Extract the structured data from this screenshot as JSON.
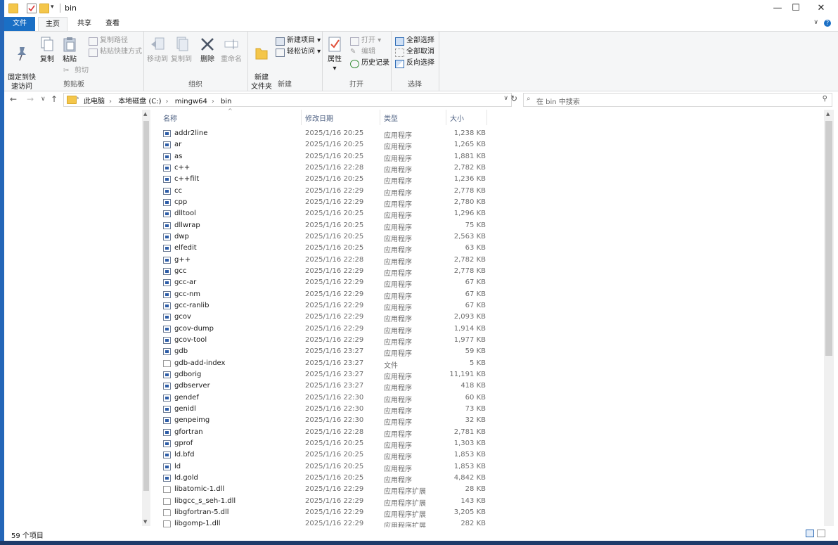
{
  "window": {
    "title": "bin"
  },
  "tabs": [
    {
      "label": "文件"
    },
    {
      "label": "主页"
    },
    {
      "label": "共享"
    },
    {
      "label": "查看"
    }
  ],
  "ribbon": {
    "clipboard": {
      "label": "剪贴板",
      "pin": "固定到快\n速访问",
      "copy": "复制",
      "paste": "粘贴",
      "copy_path": "复制路径",
      "paste_shortcut": "粘贴快捷方式",
      "cut": "剪切"
    },
    "organize": {
      "label": "组织",
      "move_to": "移动到",
      "copy_to": "复制到",
      "delete": "删除",
      "rename": "重命名"
    },
    "new": {
      "label": "新建",
      "new_folder": "新建\n文件夹",
      "new_item": "新建项目",
      "easy_access": "轻松访问"
    },
    "open": {
      "label": "打开",
      "properties": "属性",
      "open": "打开",
      "edit": "编辑",
      "history": "历史记录"
    },
    "select": {
      "label": "选择",
      "select_all": "全部选择",
      "select_none": "全部取消",
      "invert": "反向选择"
    }
  },
  "address": {
    "crumbs": [
      "此电脑",
      "本地磁盘 (C:)",
      "mingw64",
      "bin"
    ]
  },
  "search": {
    "placeholder": "在 bin 中搜索"
  },
  "columns": {
    "name": "名称",
    "date": "修改日期",
    "type": "类型",
    "size": "大小"
  },
  "files": [
    {
      "name": "addr2line",
      "date": "2025/1/16 20:25",
      "type": "应用程序",
      "size": "1,238 KB",
      "icon": "exe"
    },
    {
      "name": "ar",
      "date": "2025/1/16 20:25",
      "type": "应用程序",
      "size": "1,265 KB",
      "icon": "exe"
    },
    {
      "name": "as",
      "date": "2025/1/16 20:25",
      "type": "应用程序",
      "size": "1,881 KB",
      "icon": "exe"
    },
    {
      "name": "c++",
      "date": "2025/1/16 22:28",
      "type": "应用程序",
      "size": "2,782 KB",
      "icon": "exe"
    },
    {
      "name": "c++filt",
      "date": "2025/1/16 20:25",
      "type": "应用程序",
      "size": "1,236 KB",
      "icon": "exe"
    },
    {
      "name": "cc",
      "date": "2025/1/16 22:29",
      "type": "应用程序",
      "size": "2,778 KB",
      "icon": "exe"
    },
    {
      "name": "cpp",
      "date": "2025/1/16 22:29",
      "type": "应用程序",
      "size": "2,780 KB",
      "icon": "exe"
    },
    {
      "name": "dlltool",
      "date": "2025/1/16 20:25",
      "type": "应用程序",
      "size": "1,296 KB",
      "icon": "exe"
    },
    {
      "name": "dllwrap",
      "date": "2025/1/16 20:25",
      "type": "应用程序",
      "size": "75 KB",
      "icon": "exe"
    },
    {
      "name": "dwp",
      "date": "2025/1/16 20:25",
      "type": "应用程序",
      "size": "2,563 KB",
      "icon": "exe"
    },
    {
      "name": "elfedit",
      "date": "2025/1/16 20:25",
      "type": "应用程序",
      "size": "63 KB",
      "icon": "exe"
    },
    {
      "name": "g++",
      "date": "2025/1/16 22:28",
      "type": "应用程序",
      "size": "2,782 KB",
      "icon": "exe"
    },
    {
      "name": "gcc",
      "date": "2025/1/16 22:29",
      "type": "应用程序",
      "size": "2,778 KB",
      "icon": "exe"
    },
    {
      "name": "gcc-ar",
      "date": "2025/1/16 22:29",
      "type": "应用程序",
      "size": "67 KB",
      "icon": "exe"
    },
    {
      "name": "gcc-nm",
      "date": "2025/1/16 22:29",
      "type": "应用程序",
      "size": "67 KB",
      "icon": "exe"
    },
    {
      "name": "gcc-ranlib",
      "date": "2025/1/16 22:29",
      "type": "应用程序",
      "size": "67 KB",
      "icon": "exe"
    },
    {
      "name": "gcov",
      "date": "2025/1/16 22:29",
      "type": "应用程序",
      "size": "2,093 KB",
      "icon": "exe"
    },
    {
      "name": "gcov-dump",
      "date": "2025/1/16 22:29",
      "type": "应用程序",
      "size": "1,914 KB",
      "icon": "exe"
    },
    {
      "name": "gcov-tool",
      "date": "2025/1/16 22:29",
      "type": "应用程序",
      "size": "1,977 KB",
      "icon": "exe"
    },
    {
      "name": "gdb",
      "date": "2025/1/16 23:27",
      "type": "应用程序",
      "size": "59 KB",
      "icon": "exe"
    },
    {
      "name": "gdb-add-index",
      "date": "2025/1/16 23:27",
      "type": "文件",
      "size": "5 KB",
      "icon": "doc"
    },
    {
      "name": "gdborig",
      "date": "2025/1/16 23:27",
      "type": "应用程序",
      "size": "11,191 KB",
      "icon": "exe"
    },
    {
      "name": "gdbserver",
      "date": "2025/1/16 23:27",
      "type": "应用程序",
      "size": "418 KB",
      "icon": "exe"
    },
    {
      "name": "gendef",
      "date": "2025/1/16 22:30",
      "type": "应用程序",
      "size": "60 KB",
      "icon": "exe"
    },
    {
      "name": "genidl",
      "date": "2025/1/16 22:30",
      "type": "应用程序",
      "size": "73 KB",
      "icon": "exe"
    },
    {
      "name": "genpeimg",
      "date": "2025/1/16 22:30",
      "type": "应用程序",
      "size": "32 KB",
      "icon": "exe"
    },
    {
      "name": "gfortran",
      "date": "2025/1/16 22:28",
      "type": "应用程序",
      "size": "2,781 KB",
      "icon": "exe"
    },
    {
      "name": "gprof",
      "date": "2025/1/16 20:25",
      "type": "应用程序",
      "size": "1,303 KB",
      "icon": "exe"
    },
    {
      "name": "ld.bfd",
      "date": "2025/1/16 20:25",
      "type": "应用程序",
      "size": "1,853 KB",
      "icon": "exe"
    },
    {
      "name": "ld",
      "date": "2025/1/16 20:25",
      "type": "应用程序",
      "size": "1,853 KB",
      "icon": "exe"
    },
    {
      "name": "ld.gold",
      "date": "2025/1/16 20:25",
      "type": "应用程序",
      "size": "4,842 KB",
      "icon": "exe"
    },
    {
      "name": "libatomic-1.dll",
      "date": "2025/1/16 22:29",
      "type": "应用程序扩展",
      "size": "28 KB",
      "icon": "dll"
    },
    {
      "name": "libgcc_s_seh-1.dll",
      "date": "2025/1/16 22:29",
      "type": "应用程序扩展",
      "size": "143 KB",
      "icon": "dll"
    },
    {
      "name": "libgfortran-5.dll",
      "date": "2025/1/16 22:29",
      "type": "应用程序扩展",
      "size": "3,205 KB",
      "icon": "dll"
    },
    {
      "name": "libgomp-1.dll",
      "date": "2025/1/16 22:29",
      "type": "应用程序扩展",
      "size": "282 KB",
      "icon": "dll"
    }
  ],
  "status": {
    "count": "59 个项目"
  },
  "colors": {
    "accent": "#1a6fc5",
    "ribbon_bg": "#f5f6f7",
    "header_text": "#4d6082"
  }
}
